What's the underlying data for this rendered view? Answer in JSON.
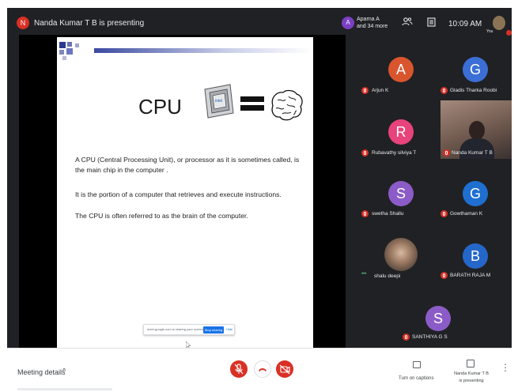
{
  "topbar": {
    "presenter_initial": "N",
    "presenter_text": "Nanda Kumar T B is presenting",
    "people_initial": "A",
    "people_line1": "Aparna A",
    "people_line2": "and 34 more",
    "people_icon": "people-icon",
    "chat_icon": "chat-icon",
    "time": "10:09 AM",
    "you_label": "You"
  },
  "slide": {
    "title": "CPU",
    "paragraphs": [
      "A CPU (Central Processing Unit), or processor as it is sometimes  called, is the main chip in the computer .",
      "It is the portion of a computer that retrieves and execute instructions.",
      "The CPU is often referred to as the brain of the computer."
    ],
    "share_notice": "meet.google.com is sharing your screen.",
    "stop_sharing": "Stop sharing",
    "hide": "Hide"
  },
  "participants": [
    {
      "initial": "A",
      "name": "Arjun K",
      "color": "#d9552e"
    },
    {
      "initial": "G",
      "name": "Gladis Tharka Roobi",
      "color": "#3b6fd6"
    },
    {
      "initial": "R",
      "name": "Rubavathy silviya T",
      "color": "#e8437a"
    },
    {
      "initial": "",
      "name": "Nanda Kumar T B",
      "color": ""
    },
    {
      "initial": "S",
      "name": "swetha Shallu",
      "color": "#8b5cc7"
    },
    {
      "initial": "G",
      "name": "Gowthaman K",
      "color": "#1f6fd0"
    },
    {
      "initial": "",
      "name": "shalu deepi",
      "color": ""
    },
    {
      "initial": "B",
      "name": "BARATH RAJA M",
      "color": "#2567c9"
    },
    {
      "initial": "S",
      "name": "SANTHIYA G S",
      "color": "#8b5cc7"
    }
  ],
  "bottombar": {
    "meeting_details": "Meeting details",
    "chevron": "^",
    "captions_label": "Turn on captions",
    "presenting_line1": "Nanda Kumar T B",
    "presenting_line2": "is presenting",
    "kebab": "⋮"
  },
  "colors": {
    "background": "#202124",
    "mute_red": "#d93025",
    "accent_blue": "#1a73e8"
  }
}
